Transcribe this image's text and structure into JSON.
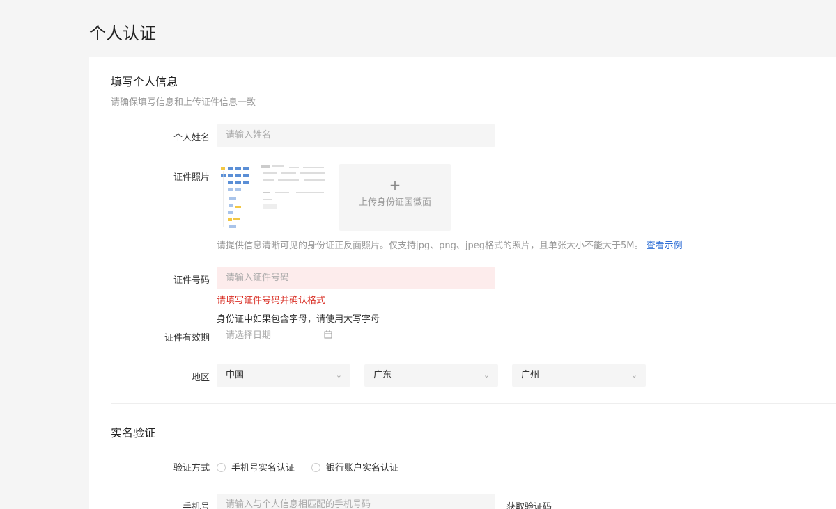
{
  "page_title": "个人认证",
  "personal_info": {
    "title": "填写个人信息",
    "subtitle": "请确保填写信息和上传证件信息一致",
    "name": {
      "label": "个人姓名",
      "placeholder": "请输入姓名"
    },
    "photo": {
      "label": "证件照片",
      "upload_label": "上传身份证国徽面",
      "hint": "请提供信息清晰可见的身份证正反面照片。仅支持jpg、png、jpeg格式的照片，且单张大小不能大于5M。",
      "example_link": "查看示例"
    },
    "id_number": {
      "label": "证件号码",
      "placeholder": "请输入证件号码",
      "error": "请填写证件号码并确认格式",
      "note": "身份证中如果包含字母，请使用大写字母"
    },
    "validity": {
      "label": "证件有效期",
      "placeholder": "请选择日期",
      "icon": "calendar-icon"
    },
    "region": {
      "label": "地区",
      "country": "中国",
      "province": "广东",
      "city": "广州"
    }
  },
  "verification": {
    "title": "实名验证",
    "method": {
      "label": "验证方式",
      "options": [
        "手机号实名认证",
        "银行账户实名认证"
      ]
    },
    "phone": {
      "label": "手机号",
      "placeholder": "请输入与个人信息相匹配的手机号码",
      "get_code": "获取验证码"
    }
  },
  "colors": {
    "link": "#2f6fd6",
    "error": "#d93026",
    "error_bg": "#fdecec"
  }
}
